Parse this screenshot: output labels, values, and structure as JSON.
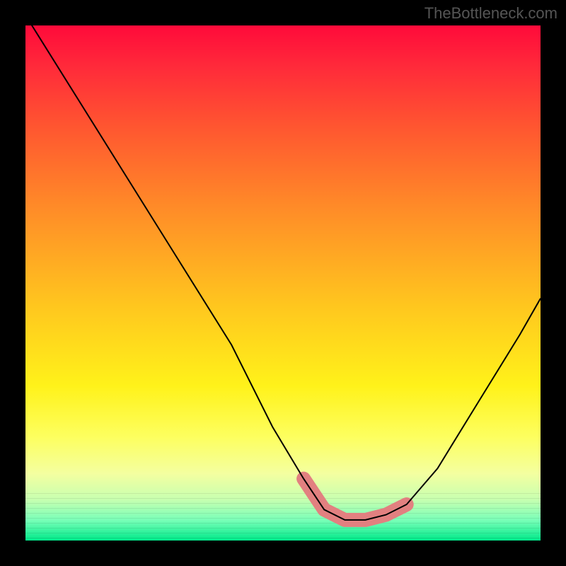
{
  "watermark": "TheBottleneck.com",
  "chart_data": {
    "type": "line",
    "title": "",
    "xlabel": "",
    "ylabel": "",
    "xlim": [
      0,
      100
    ],
    "ylim": [
      0,
      100
    ],
    "grid": false,
    "series": [
      {
        "name": "curve",
        "x": [
          0,
          10,
          20,
          30,
          40,
          48,
          54,
          58,
          62,
          66,
          70,
          74,
          80,
          88,
          96,
          100
        ],
        "y": [
          102,
          86,
          70,
          54,
          38,
          22,
          12,
          6,
          4,
          4,
          5,
          7,
          14,
          27,
          40,
          47
        ]
      }
    ],
    "highlight": {
      "name": "minimum-region",
      "x": [
        54,
        58,
        62,
        66,
        70,
        74
      ],
      "y": [
        12,
        6,
        4,
        4,
        5,
        7
      ],
      "color": "#e28080"
    },
    "background_gradient": {
      "top": "#ff0a3a",
      "mid": "#fff21a",
      "bottom": "#00e98a"
    }
  }
}
